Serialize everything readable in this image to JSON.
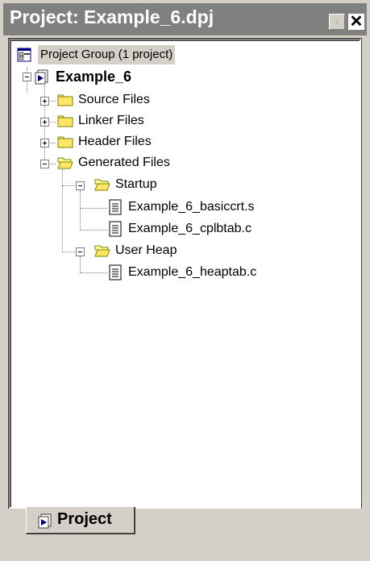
{
  "panel": {
    "title": "Project: Example_6.dpj",
    "dropdown_icon": "chevron-down-icon",
    "close_icon": "close-icon"
  },
  "tree": {
    "group_label": "Project Group (1 project)",
    "project_label": "Example_6",
    "folders": {
      "source": "Source Files",
      "linker": "Linker Files",
      "header": "Header Files",
      "generated": "Generated Files",
      "startup": "Startup",
      "user_heap": "User Heap"
    },
    "files": {
      "basiccrt": "Example_6_basiccrt.s",
      "cplbtab": "Example_6_cplbtab.c",
      "heaptab": "Example_6_heaptab.c"
    }
  },
  "tabs": {
    "project_label": "Project"
  },
  "colors": {
    "titlebar": "#808080",
    "folder_yellow": "#ffff99",
    "folder_outline": "#808000",
    "panel_bg": "#d4d0c8"
  }
}
